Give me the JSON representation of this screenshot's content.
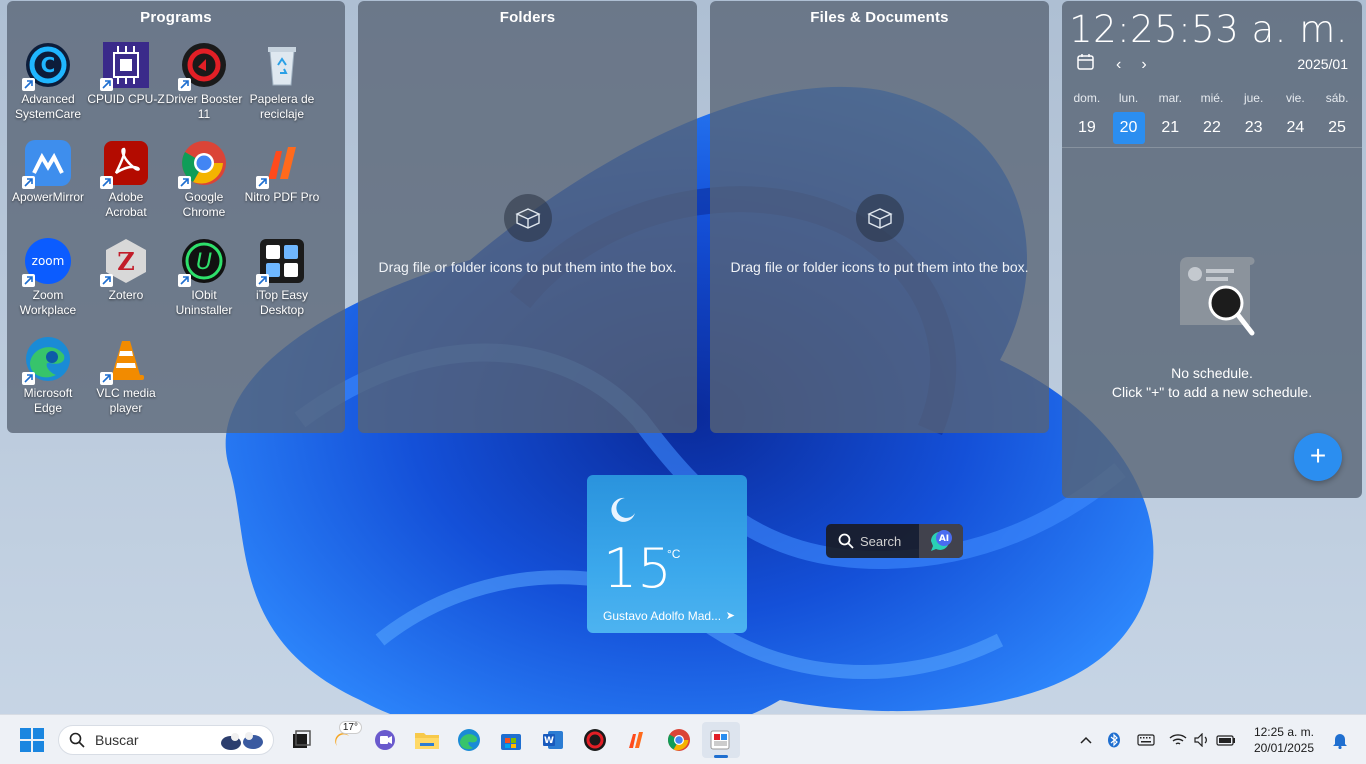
{
  "fences": {
    "programs": {
      "title": "Programs",
      "items": [
        {
          "label": "Advanced SystemCare",
          "icon": "advanced-systemcare-icon"
        },
        {
          "label": "CPUID CPU-Z",
          "icon": "cpuz-icon"
        },
        {
          "label": "Driver Booster 11",
          "icon": "driver-booster-icon"
        },
        {
          "label": "Papelera de reciclaje",
          "icon": "recycle-bin-icon"
        },
        {
          "label": "ApowerMirror",
          "icon": "apowermirror-icon"
        },
        {
          "label": "Adobe Acrobat",
          "icon": "adobe-acrobat-icon"
        },
        {
          "label": "Google Chrome",
          "icon": "chrome-icon"
        },
        {
          "label": "Nitro PDF Pro",
          "icon": "nitro-pdf-icon"
        },
        {
          "label": "Zoom Workplace",
          "icon": "zoom-icon"
        },
        {
          "label": "Zotero",
          "icon": "zotero-icon"
        },
        {
          "label": "IObit Uninstaller",
          "icon": "iobit-uninstaller-icon"
        },
        {
          "label": "iTop Easy Desktop",
          "icon": "itop-easy-desktop-icon"
        },
        {
          "label": "Microsoft Edge",
          "icon": "edge-icon"
        },
        {
          "label": "VLC media player",
          "icon": "vlc-icon"
        }
      ]
    },
    "folders": {
      "title": "Folders",
      "empty_text": "Drag file or folder icons to put them into the box."
    },
    "files": {
      "title": "Files & Documents",
      "empty_text": "Drag file or folder icons to put them into the box."
    }
  },
  "calendar": {
    "clock": "12:25:53 a. m.",
    "month": "2025/01",
    "days": [
      {
        "name": "dom.",
        "num": "19"
      },
      {
        "name": "lun.",
        "num": "20",
        "today": true
      },
      {
        "name": "mar.",
        "num": "21"
      },
      {
        "name": "mié.",
        "num": "22"
      },
      {
        "name": "jue.",
        "num": "23"
      },
      {
        "name": "vie.",
        "num": "24"
      },
      {
        "name": "sáb.",
        "num": "25"
      }
    ],
    "no_schedule": "No schedule.",
    "hint": "Click \"+\" to add a new schedule.",
    "add_label": "+"
  },
  "weather": {
    "temp": "15",
    "unit": "°C",
    "location": "Gustavo Adolfo Mad..."
  },
  "search_widget": {
    "label": "Search",
    "ai_label": "AI"
  },
  "taskbar": {
    "search_placeholder": "Buscar",
    "weather_badge": "17°",
    "apps": [
      "task-view-icon",
      "weather-icon",
      "teams-icon",
      "file-explorer-icon",
      "edge-icon",
      "store-icon",
      "word-icon",
      "driver-booster-icon",
      "nitro-pdf-icon",
      "chrome-icon",
      "itop-easy-desktop-icon"
    ],
    "time": "12:25 a. m.",
    "date": "20/01/2025"
  },
  "colors": {
    "accent": "#2b8ef0",
    "fence_bg": "#58647a"
  }
}
